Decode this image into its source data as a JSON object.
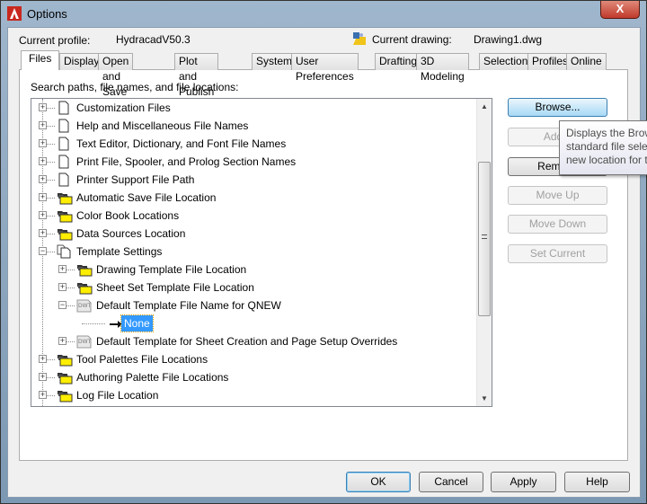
{
  "window": {
    "title": "Options",
    "close_label": "X"
  },
  "profile": {
    "current_profile_label": "Current profile:",
    "current_profile_value": "HydracadV50.3",
    "current_drawing_label": "Current drawing:",
    "current_drawing_value": "Drawing1.dwg"
  },
  "tabs": [
    {
      "label": "Files",
      "active": true
    },
    {
      "label": "Display"
    },
    {
      "label": "Open and Save"
    },
    {
      "label": "Plot and Publish"
    },
    {
      "label": "System"
    },
    {
      "label": "User Preferences"
    },
    {
      "label": "Drafting"
    },
    {
      "label": "3D Modeling"
    },
    {
      "label": "Selection"
    },
    {
      "label": "Profiles"
    },
    {
      "label": "Online"
    }
  ],
  "files": {
    "search_label": "Search paths, file names, and file locations:",
    "tree": [
      {
        "label": "Customization Files",
        "level": 0,
        "icon": "page-icon",
        "expander": "plus"
      },
      {
        "label": "Help and Miscellaneous File Names",
        "level": 0,
        "icon": "page-icon",
        "expander": "plus"
      },
      {
        "label": "Text Editor, Dictionary, and Font File Names",
        "level": 0,
        "icon": "page-icon",
        "expander": "plus"
      },
      {
        "label": "Print File, Spooler, and Prolog Section Names",
        "level": 0,
        "icon": "page-icon",
        "expander": "plus"
      },
      {
        "label": "Printer Support File Path",
        "level": 0,
        "icon": "page-icon",
        "expander": "plus"
      },
      {
        "label": "Automatic Save File Location",
        "level": 0,
        "icon": "folder-icon",
        "expander": "plus"
      },
      {
        "label": "Color Book Locations",
        "level": 0,
        "icon": "folder-icon",
        "expander": "plus"
      },
      {
        "label": "Data Sources Location",
        "level": 0,
        "icon": "folder-icon",
        "expander": "plus"
      },
      {
        "label": "Template Settings",
        "level": 0,
        "icon": "pages-icon",
        "expander": "minus"
      },
      {
        "label": "Drawing Template File Location",
        "level": 1,
        "icon": "folder-icon",
        "expander": "plus"
      },
      {
        "label": "Sheet Set Template File Location",
        "level": 1,
        "icon": "folder-icon",
        "expander": "plus"
      },
      {
        "label": "Default Template File Name for QNEW",
        "level": 1,
        "icon": "dwt-icon",
        "expander": "minus"
      },
      {
        "label": "None",
        "level": 2,
        "icon": "arrow-icon",
        "expander": "none",
        "selected": true
      },
      {
        "label": "Default Template for Sheet Creation and Page Setup Overrides",
        "level": 1,
        "icon": "dwt-icon",
        "expander": "plus"
      },
      {
        "label": "Tool Palettes File Locations",
        "level": 0,
        "icon": "folder-icon",
        "expander": "plus"
      },
      {
        "label": "Authoring Palette File Locations",
        "level": 0,
        "icon": "folder-icon",
        "expander": "plus"
      },
      {
        "label": "Log File Location",
        "level": 0,
        "icon": "folder-icon",
        "expander": "plus"
      }
    ],
    "buttons": {
      "browse": "Browse...",
      "add": "Add...",
      "remove": "Remove",
      "move_up": "Move Up",
      "move_down": "Move Down",
      "set_current": "Set Current"
    },
    "tooltip": [
      "Displays the Brow",
      "standard file selec",
      "new location for t"
    ]
  },
  "footer": {
    "ok": "OK",
    "cancel": "Cancel",
    "apply": "Apply",
    "help": "Help"
  },
  "colors": {
    "selection": "#3399ff",
    "folder": "#ffee00",
    "hot_button": "#a7d9f5"
  }
}
